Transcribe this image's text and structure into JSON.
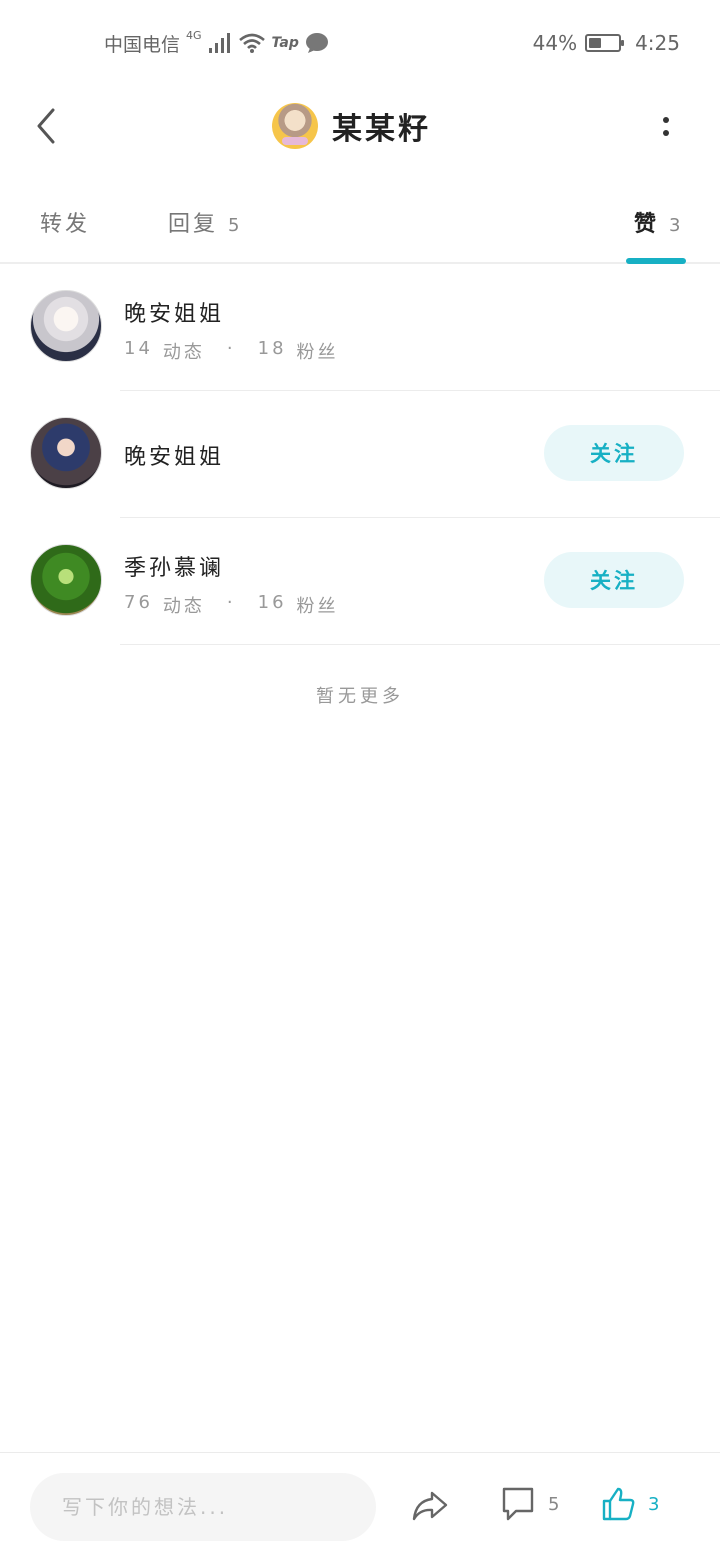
{
  "status_bar": {
    "carrier": "中国电信",
    "network": "4G",
    "app_indicator": "Tap",
    "battery_percent_text": "44%",
    "battery_level": 0.44,
    "time": "4:25"
  },
  "header": {
    "title": "某某籽",
    "back_icon": "chevron-left-icon",
    "more_icon": "more-vertical-icon"
  },
  "tabs": [
    {
      "label": "转发",
      "count": ""
    },
    {
      "label": "回复",
      "count": "5"
    },
    {
      "label": "赞",
      "count": "3"
    }
  ],
  "active_tab": "赞",
  "accent_color": "#17b0c4",
  "likes": [
    {
      "name": "晚安姐姐",
      "posts": "14",
      "posts_label": "动态",
      "fans": "18",
      "fans_label": "粉丝",
      "follow_label": ""
    },
    {
      "name": "晚安姐姐",
      "posts": "",
      "posts_label": "",
      "fans": "",
      "fans_label": "",
      "follow_label": "关注"
    },
    {
      "name": "季孙慕谰",
      "posts": "76",
      "posts_label": "动态",
      "fans": "16",
      "fans_label": "粉丝",
      "follow_label": "关注"
    }
  ],
  "stats_separator": "·",
  "no_more_text": "暂无更多",
  "bottom_bar": {
    "input_placeholder": "写下你的想法...",
    "share_icon": "share-arrow-icon",
    "comment_icon": "comment-bubble-icon",
    "comment_count": "5",
    "like_icon": "thumbs-up-icon",
    "like_count": "3"
  }
}
